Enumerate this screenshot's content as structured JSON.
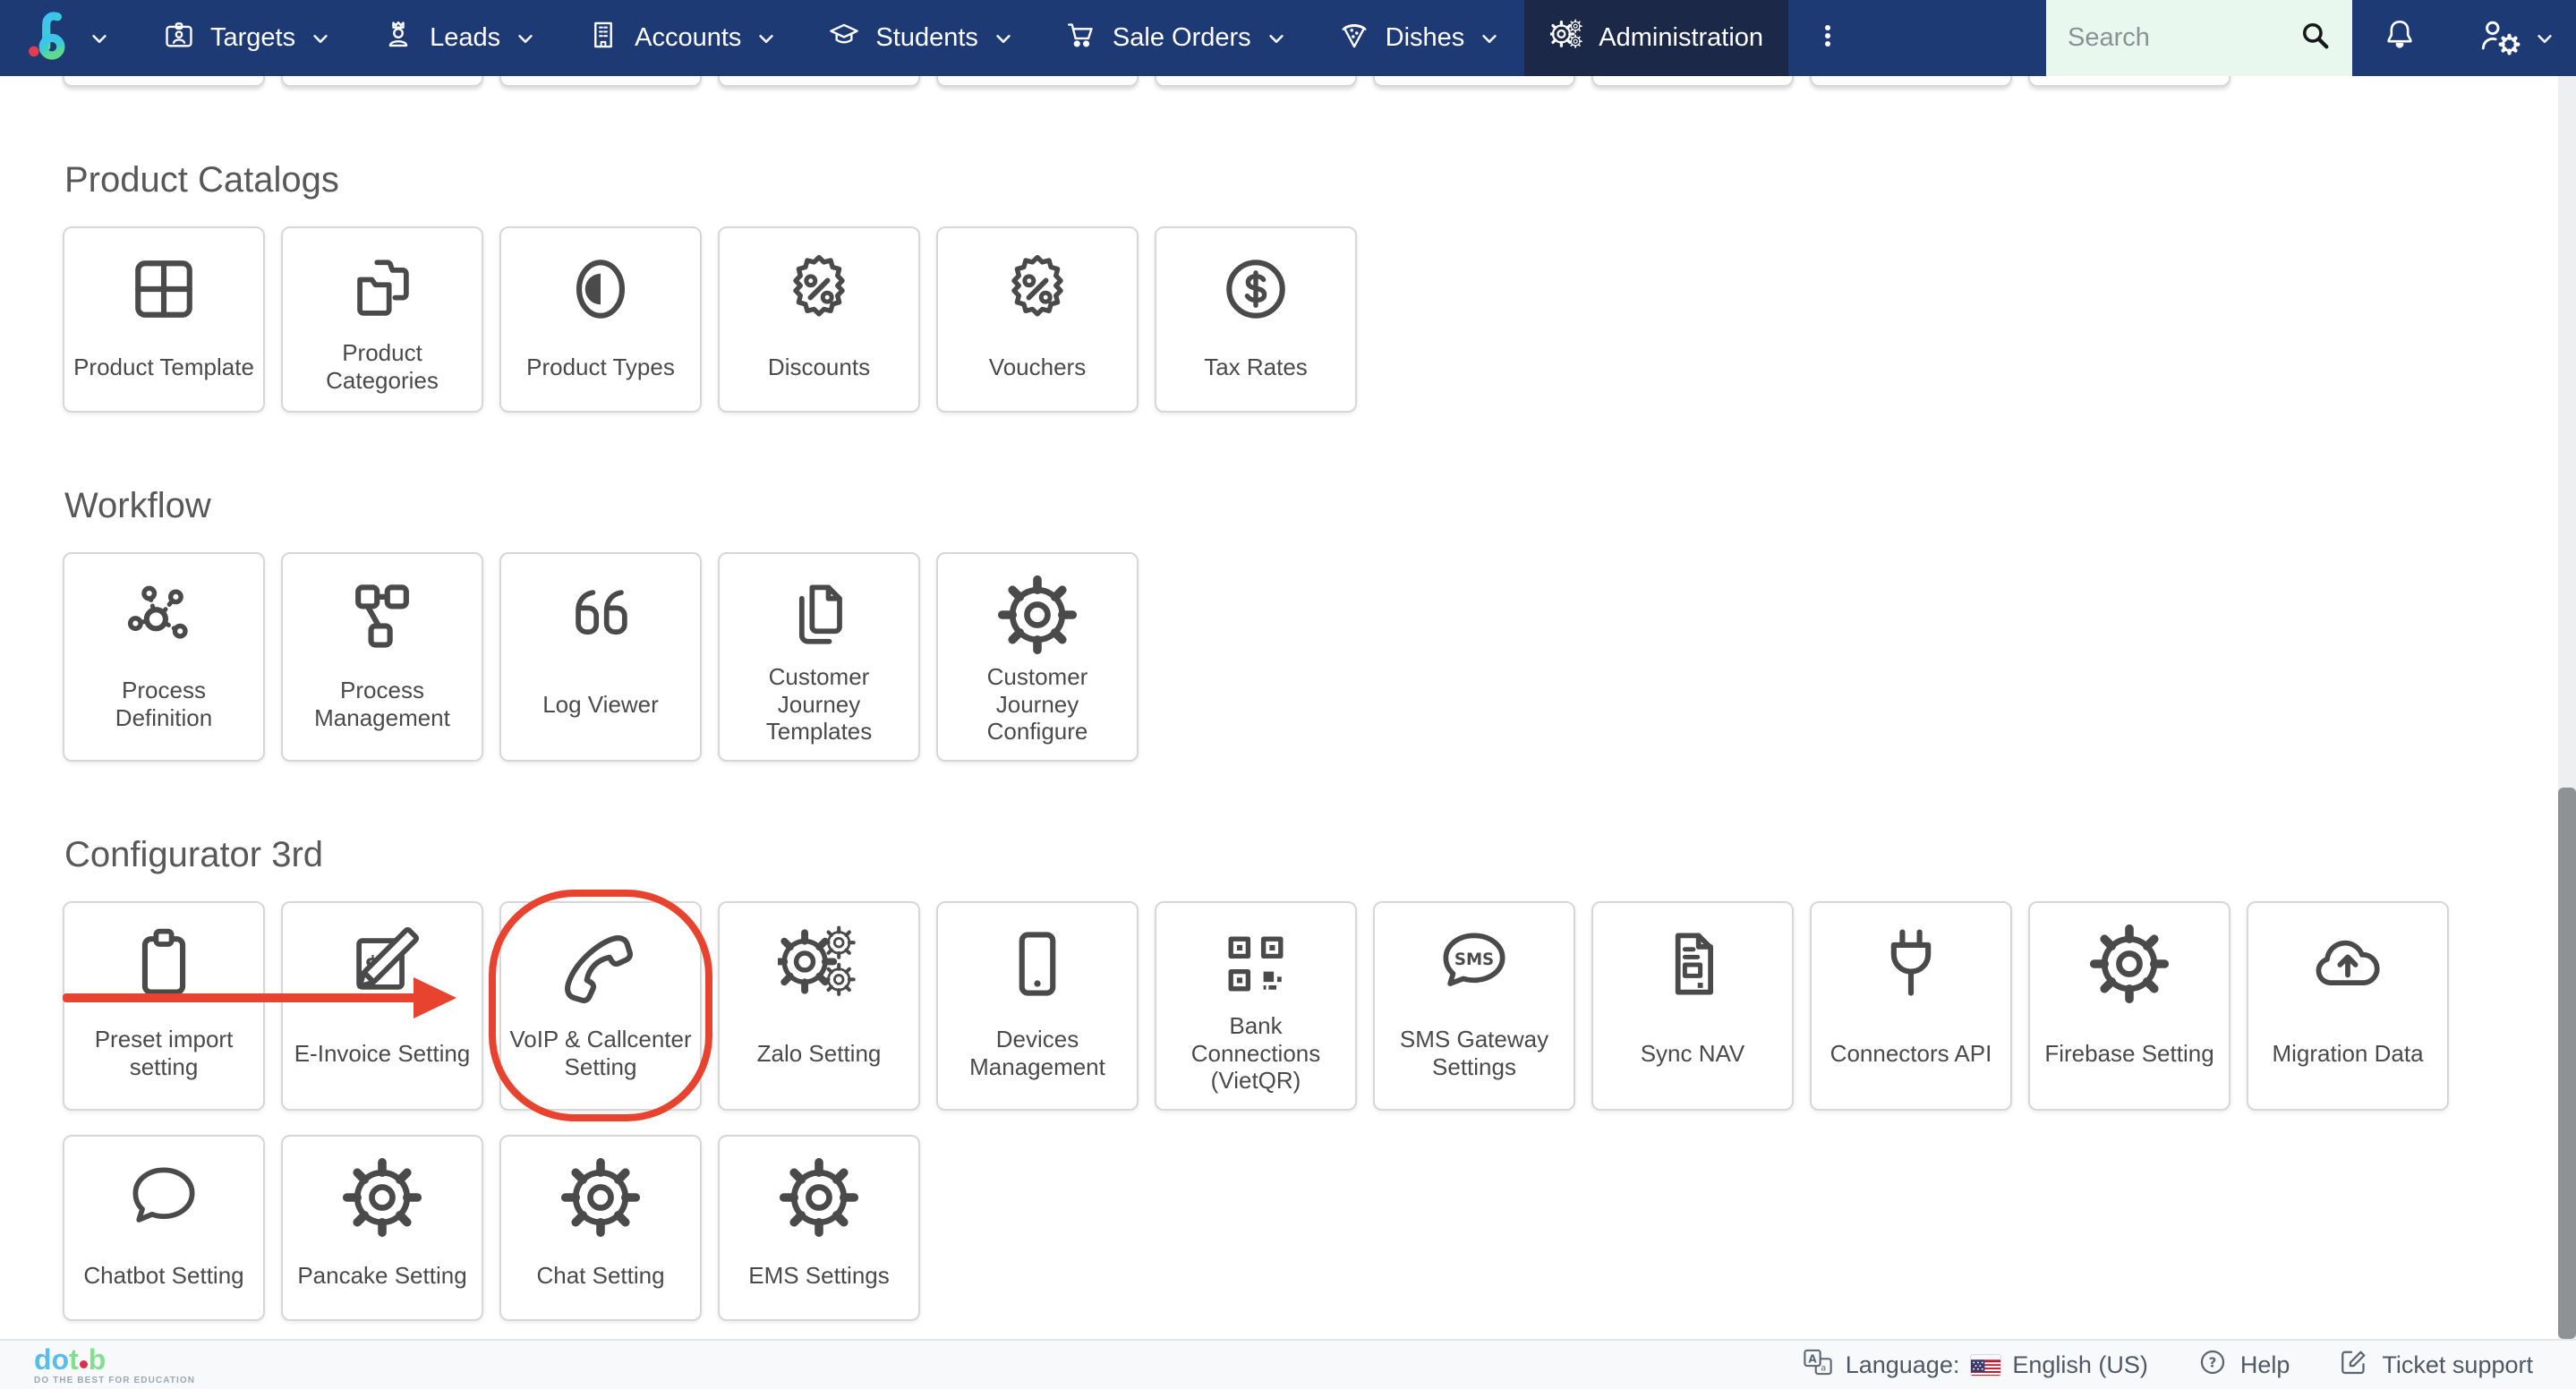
{
  "colors": {
    "nav_background": "#1e3a74",
    "nav_active_background": "#1b2847",
    "search_background": "#e8f8ee",
    "annotation_red": "#e8432e",
    "card_icon_gray": "#4a4a4a",
    "logo_blue": "#58bdec",
    "logo_green": "#84dd92",
    "logo_red_dot": "#d9314b"
  },
  "nav": {
    "brand": {
      "logo_icon": "b-logo-icon",
      "chevron_icon": "chevron-down-icon"
    },
    "items": [
      {
        "label": "Targets",
        "icon": "id-card-icon",
        "active": false
      },
      {
        "label": "Leads",
        "icon": "person-crown-icon",
        "active": false
      },
      {
        "label": "Accounts",
        "icon": "building-icon",
        "active": false
      },
      {
        "label": "Students",
        "icon": "grad-cap-icon",
        "active": false
      },
      {
        "label": "Sale Orders",
        "icon": "cart-icon",
        "active": false
      },
      {
        "label": "Dishes",
        "icon": "pizza-icon",
        "active": false
      },
      {
        "label": "Administration",
        "icon": "gears-cluster-icon",
        "active": true
      }
    ],
    "overflow_menu_icon": "three-dots-icon",
    "search": {
      "placeholder": "Search",
      "icon": "search-icon"
    },
    "notifications_icon": "bell-icon",
    "user_menu_icon": "user-gear-icon"
  },
  "top_cut_row": {
    "count": 10
  },
  "sections": [
    {
      "title": "Product Catalogs",
      "items": [
        {
          "label": "Product Template",
          "icon": "grid-icon"
        },
        {
          "label": "Product Categories",
          "icon": "folders-icon"
        },
        {
          "label": "Product Types",
          "icon": "contrast-icon"
        },
        {
          "label": "Discounts",
          "icon": "seal-percent-icon"
        },
        {
          "label": "Vouchers",
          "icon": "seal-percent-icon"
        },
        {
          "label": "Tax Rates",
          "icon": "dollar-circle-icon"
        }
      ]
    },
    {
      "title": "Workflow",
      "items": [
        {
          "label": "Process Definition",
          "icon": "network-icon"
        },
        {
          "label": "Process Management",
          "icon": "flowchart-icon"
        },
        {
          "label": "Log Viewer",
          "icon": "quote-icon"
        },
        {
          "label": "Customer Journey Templates",
          "icon": "copy-pages-icon"
        },
        {
          "label": "Customer Journey Configure",
          "icon": "gear-icon"
        }
      ]
    },
    {
      "title": "Configurator 3rd",
      "items": [
        {
          "label": "Preset import setting",
          "icon": "clipboard-icon"
        },
        {
          "label": "E-Invoice Setting",
          "icon": "invoice-pencil-icon"
        },
        {
          "label": "VoIP & Callcenter Setting",
          "icon": "phone-icon",
          "annotated": true
        },
        {
          "label": "Zalo Setting",
          "icon": "gears-cluster-icon"
        },
        {
          "label": "Devices Management",
          "icon": "tablet-icon"
        },
        {
          "label": "Bank Connections (VietQR)",
          "icon": "qr-icon"
        },
        {
          "label": "SMS Gateway Settings",
          "icon": "sms-bubble-icon"
        },
        {
          "label": "Sync NAV",
          "icon": "receipt-icon"
        },
        {
          "label": "Connectors API",
          "icon": "plug-icon"
        },
        {
          "label": "Firebase Setting",
          "icon": "gear-icon"
        },
        {
          "label": "Migration Data",
          "icon": "cloud-upload-icon"
        },
        {
          "label": "Chatbot Setting",
          "icon": "chat-bubble-icon"
        },
        {
          "label": "Pancake Setting",
          "icon": "gear-icon"
        },
        {
          "label": "Chat Setting",
          "icon": "gear-icon"
        },
        {
          "label": "EMS Settings",
          "icon": "gear-icon"
        }
      ]
    }
  ],
  "annotation": {
    "type": "red ellipse with arrow",
    "target": "VoIP & Callcenter Setting",
    "color": "#e8432e"
  },
  "footer": {
    "logo": {
      "text_blue": "do",
      "text_green_t": "t",
      "text_green_b": "b",
      "tagline": "DO THE BEST FOR EDUCATION"
    },
    "language_label": "Language:",
    "language_value": "English (US)",
    "language_icon": "translate-icon",
    "flag_icon": "us-flag-icon",
    "help_label": "Help",
    "help_icon": "question-circle-icon",
    "ticket_label": "Ticket support",
    "ticket_icon": "edit-icon"
  }
}
